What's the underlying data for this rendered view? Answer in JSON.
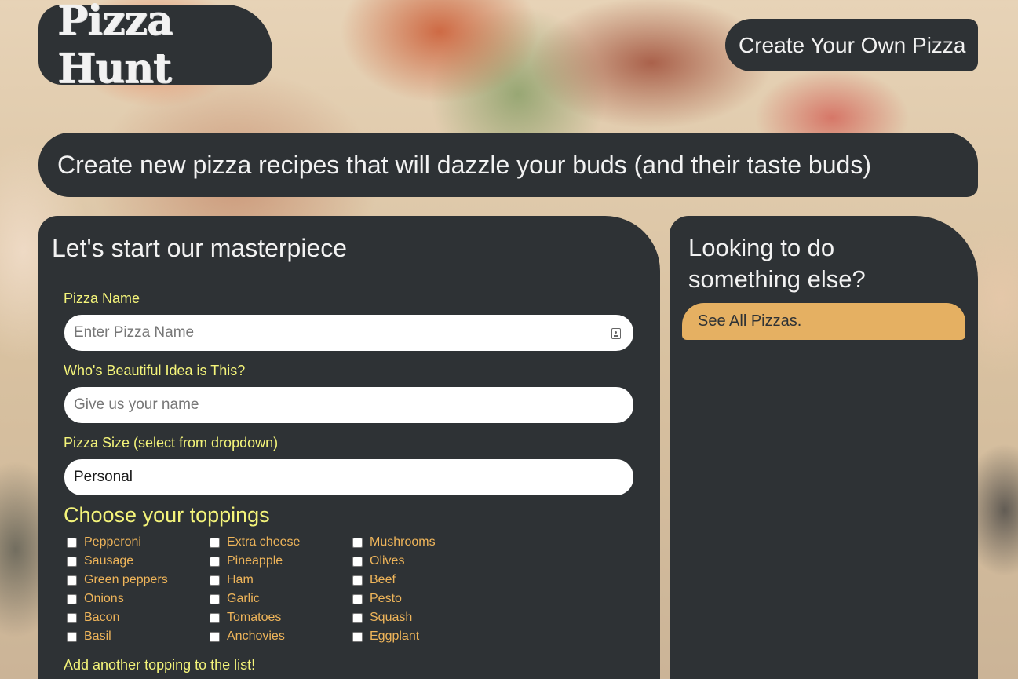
{
  "header": {
    "brand": "Pizza Hunt",
    "create_button": "Create Your Own Pizza"
  },
  "hero": {
    "text": "Create new pizza recipes that will dazzle your buds (and their taste buds)"
  },
  "form": {
    "title": "Let's start our masterpiece",
    "pizza_name": {
      "label": "Pizza Name",
      "placeholder": "Enter Pizza Name",
      "value": ""
    },
    "creator": {
      "label": "Who's Beautiful Idea is This?",
      "placeholder": "Give us your name",
      "value": ""
    },
    "size": {
      "label": "Pizza Size (select from dropdown)",
      "value": "Personal"
    },
    "toppings_title": "Choose your toppings",
    "toppings": [
      "Pepperoni",
      "Extra cheese",
      "Mushrooms",
      "Sausage",
      "Pineapple",
      "Olives",
      "Green peppers",
      "Ham",
      "Beef",
      "Onions",
      "Garlic",
      "Pesto",
      "Bacon",
      "Tomatoes",
      "Squash",
      "Basil",
      "Anchovies",
      "Eggplant"
    ],
    "add_topping_label": "Add another topping to the list!"
  },
  "sidebar": {
    "title": "Looking to do something else?",
    "see_all_button": "See All Pizzas."
  },
  "colors": {
    "panel": "#2e3235",
    "label_yellow": "#f4f47a",
    "topping_orange": "#efb55a",
    "button_gold": "#e5b062"
  }
}
